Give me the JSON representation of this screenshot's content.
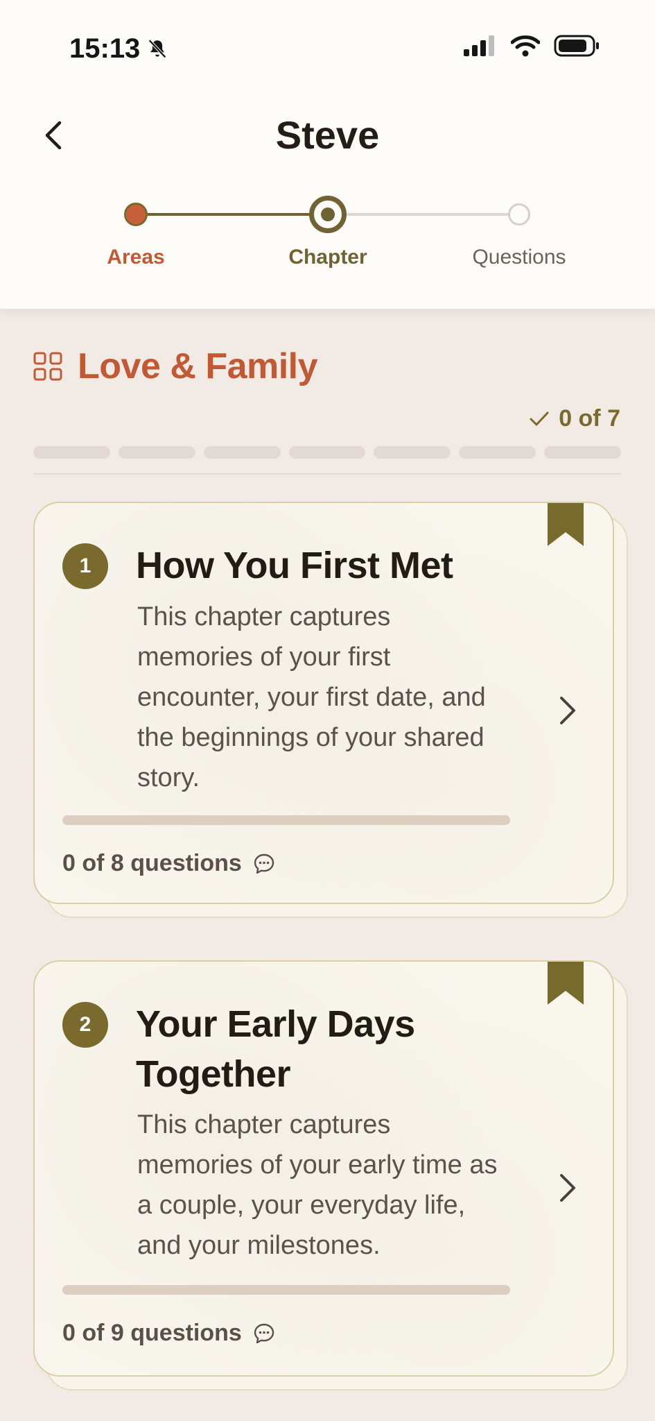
{
  "status_bar": {
    "time": "15:13"
  },
  "header": {
    "title": "Steve",
    "steps": [
      {
        "label": "Areas",
        "state": "done"
      },
      {
        "label": "Chapter",
        "state": "current"
      },
      {
        "label": "Questions",
        "state": "upcoming"
      }
    ]
  },
  "section": {
    "title": "Love & Family",
    "progress_text": "0 of 7",
    "segment_count": 7
  },
  "chapters": [
    {
      "number": "1",
      "title": "How You First Met",
      "description": "This chapter captures memories of your first encounter, your first date, and the beginnings of your shared story.",
      "questions_text": "0 of 8 questions"
    },
    {
      "number": "2",
      "title": "Your Early Days Together",
      "description": "This chapter captures memories of your early time as a couple, your everyday life, and your milestones.",
      "questions_text": "0 of 9 questions"
    }
  ],
  "colors": {
    "accent_orange": "#c15a32",
    "accent_olive": "#7a6a2e",
    "background": "#f2ebe5",
    "card": "#f9f6ee"
  }
}
